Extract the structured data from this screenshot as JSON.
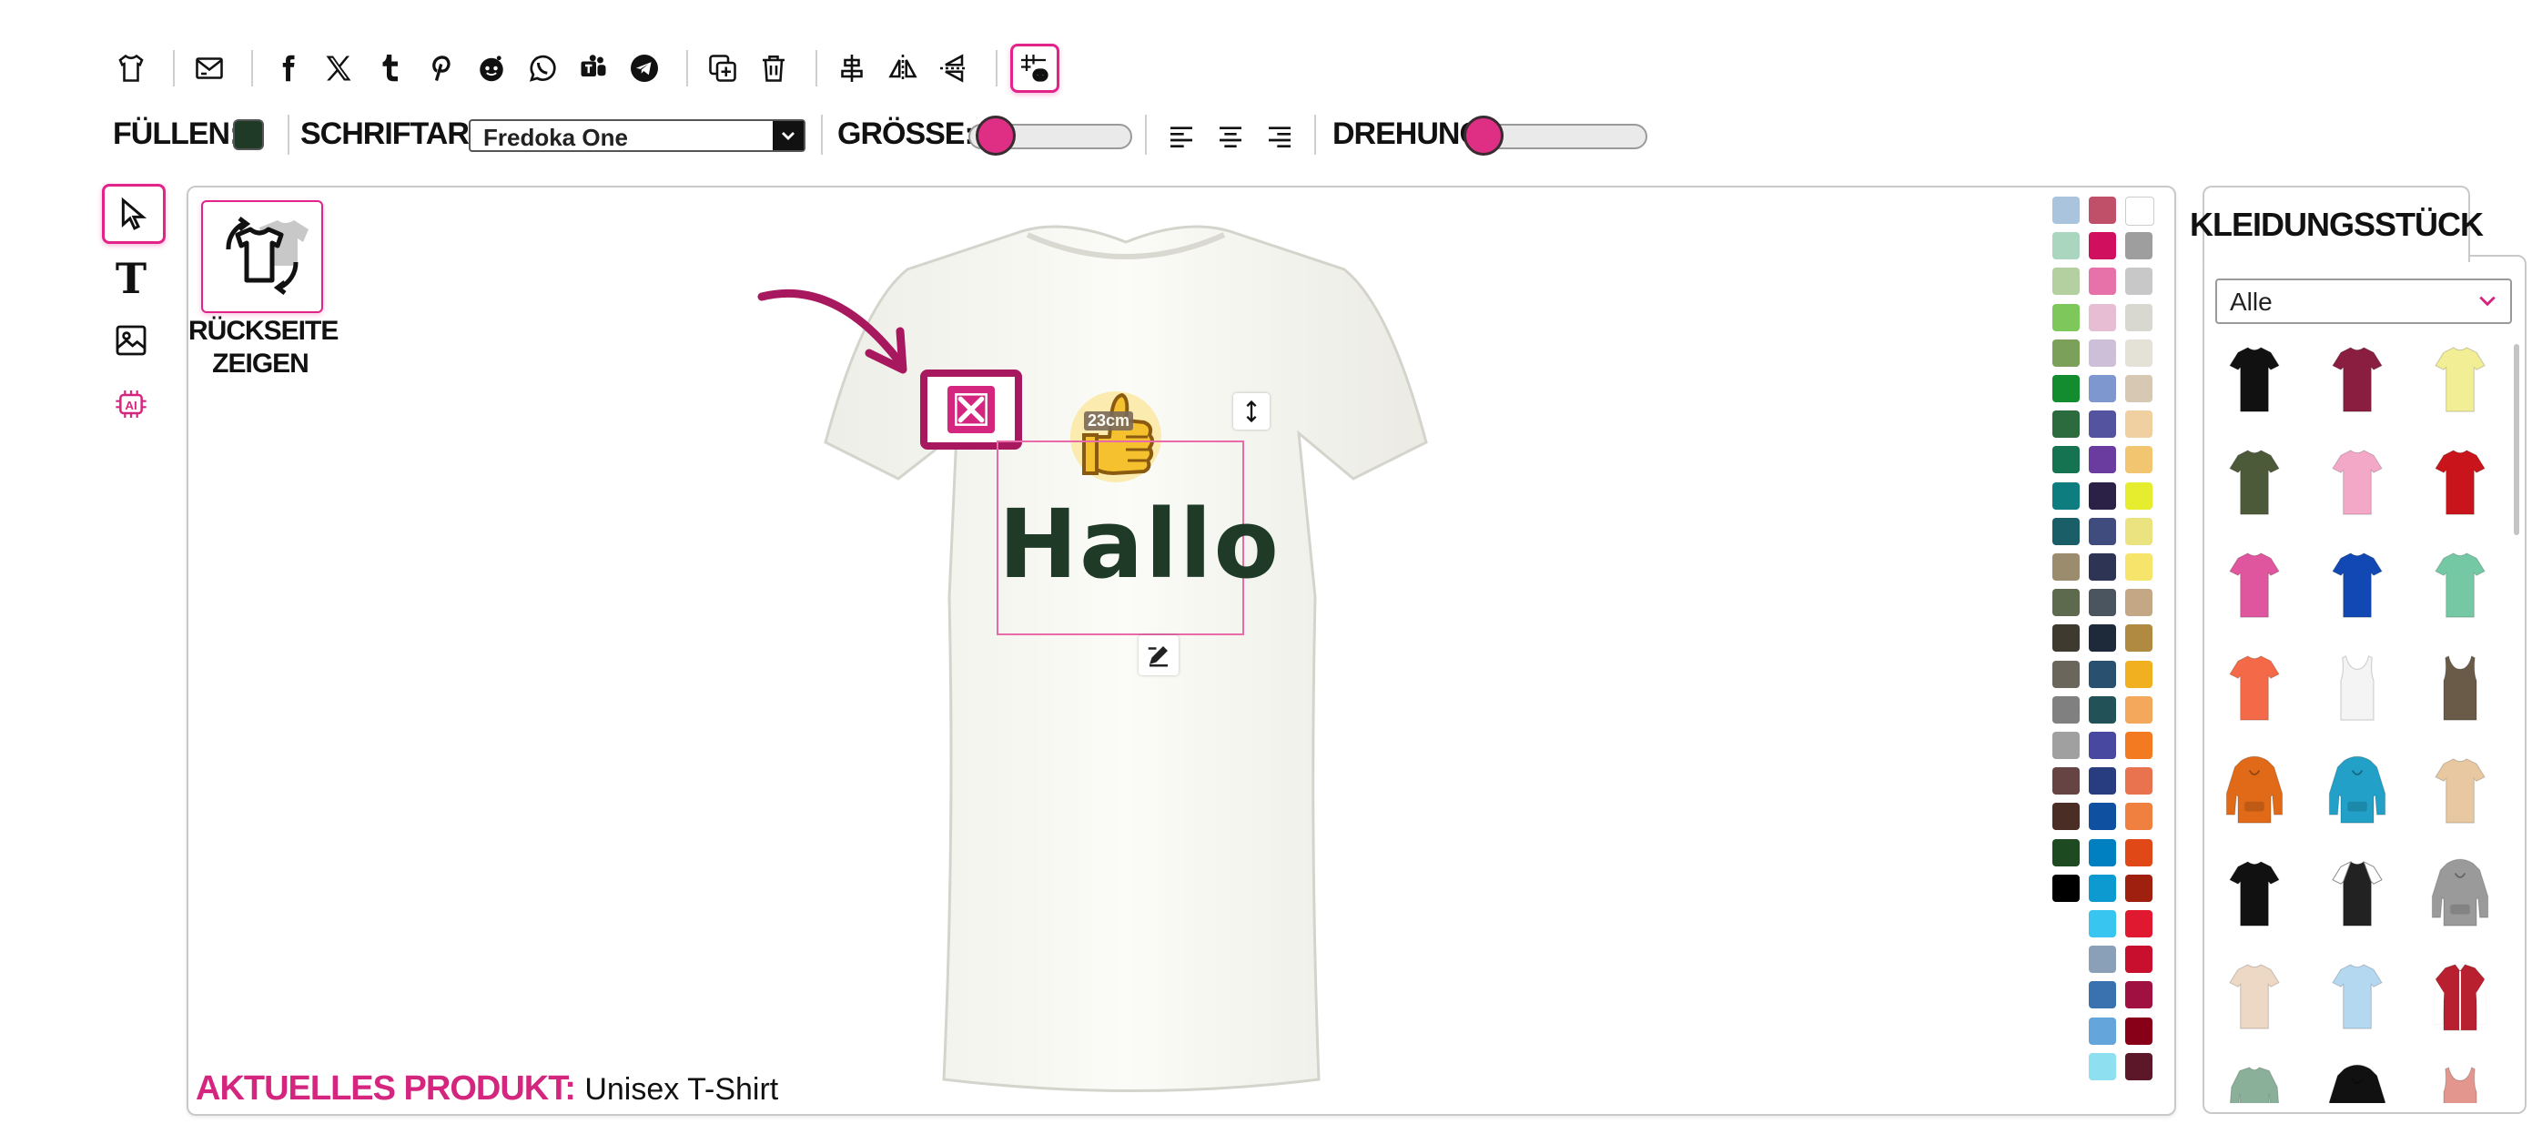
{
  "toolbar": {
    "icons": [
      "tshirt-icon",
      "envelope-icon",
      "facebook-icon",
      "x-icon",
      "tumblr-icon",
      "pinterest-icon",
      "reddit-icon",
      "whatsapp-icon",
      "teams-icon",
      "telegram-icon",
      "duplicate-icon",
      "trash-icon",
      "align-center-icon",
      "flip-horizontal-icon",
      "flip-vertical-icon",
      "grid-icon"
    ]
  },
  "options": {
    "fill_label": "FÜLLEN:",
    "fill_color": "#1f3a27",
    "font_label": "SCHRIFTART:",
    "font_value": "Fredoka One",
    "size_label": "GRÖSSE:",
    "size_fraction": 0.1,
    "rotation_label": "DREHUNG:",
    "rotation_fraction": 0.0
  },
  "left_tools": [
    "cursor-icon",
    "text-icon",
    "image-icon",
    "ai-icon"
  ],
  "canvas": {
    "back_side_label_1": "RÜCKSEITE",
    "back_side_label_2": "ZEIGEN",
    "design_text": "Hallo",
    "design_text_color": "#1f3a27",
    "size_badge": "23cm",
    "current_product_label": "AKTUELLES PRODUKT:",
    "current_product_value": "Unisex T-Shirt",
    "accent_color": "#d4267f",
    "swatch_colors": [
      [
        "#a9c4dc",
        "#c0506a",
        "#ffffff"
      ],
      [
        "#aad6c0",
        "#d0105f",
        "#9e9e9e"
      ],
      [
        "#b4cfa0",
        "#e771a9",
        "#c8c8c8"
      ],
      [
        "#7ec85b",
        "#e7bdd3",
        "#d8d8d0"
      ],
      [
        "#7aa05a",
        "#cdbfd8",
        "#e4e1d7"
      ],
      [
        "#138c2f",
        "#7f97cf",
        "#d6c8b3"
      ],
      [
        "#2b6b3e",
        "#5353a0",
        "#f0d0a0"
      ],
      [
        "#167352",
        "#6b3ca0",
        "#f2c670"
      ],
      [
        "#0e7d80",
        "#2b2146",
        "#e5ed2e"
      ],
      [
        "#1a5e68",
        "#404c7e",
        "#ebe380"
      ],
      [
        "#9b8c6e",
        "#2e3554",
        "#f6e56a"
      ],
      [
        "#5e6a4e",
        "#4b5560",
        "#c4a886"
      ],
      [
        "#3e3a2f",
        "#1e2a3a",
        "#b08a40"
      ],
      [
        "#6a665c",
        "#2a5070",
        "#f0b020"
      ],
      [
        "#808080",
        "#225258",
        "#f4a85c"
      ],
      [
        "#a0a0a0",
        "#4848a0",
        "#f37a20"
      ],
      [
        "#664444",
        "#283c80",
        "#e8734e"
      ],
      [
        "#4a2e25",
        "#1050a0",
        "#f08040"
      ],
      [
        "#1e4a22",
        "#0080c0",
        "#e04818"
      ],
      [
        "#000000",
        "#0d9ad0",
        "#a02010"
      ],
      [
        null,
        "#38c6f0",
        "#e01830"
      ],
      [
        null,
        "#8aa0b8",
        "#c8102e"
      ],
      [
        null,
        "#3a72b0",
        "#a01040"
      ],
      [
        null,
        "#64a6dc",
        "#880018"
      ],
      [
        null,
        "#8ee0f0",
        "#5c1828"
      ]
    ]
  },
  "panel": {
    "tab_label": "KLEIDUNGSSTÜCK",
    "filter_value": "Alle",
    "products": [
      {
        "color": "#111111",
        "type": "tee"
      },
      {
        "color": "#8a1e40",
        "type": "tee"
      },
      {
        "color": "#f2ee96",
        "type": "tee"
      },
      {
        "color": "#4d5a3a",
        "type": "tee"
      },
      {
        "color": "#f4a8c8",
        "type": "tee"
      },
      {
        "color": "#c8141a",
        "type": "tee"
      },
      {
        "color": "#e0569e",
        "type": "tee"
      },
      {
        "color": "#1248b4",
        "type": "tee"
      },
      {
        "color": "#74c9a4",
        "type": "tee"
      },
      {
        "color": "#f46a48",
        "type": "tee"
      },
      {
        "color": "#f4f4f4",
        "type": "tank"
      },
      {
        "color": "#6a5a48",
        "type": "tank"
      },
      {
        "color": "#e06a18",
        "type": "hoodie"
      },
      {
        "color": "#22a0c8",
        "type": "hoodie"
      },
      {
        "color": "#e8c8a0",
        "type": "tee"
      },
      {
        "color": "#111111",
        "type": "tee"
      },
      {
        "color": "#222222",
        "type": "raglan"
      },
      {
        "color": "#9a9a9a",
        "type": "hoodie"
      },
      {
        "color": "#ecd8c4",
        "type": "tee"
      },
      {
        "color": "#b4d8f0",
        "type": "tee"
      },
      {
        "color": "#b82030",
        "type": "jacket"
      },
      {
        "color": "#8ab09a",
        "type": "long"
      },
      {
        "color": "#111111",
        "type": "hoodie"
      },
      {
        "color": "#e2968e",
        "type": "tank"
      }
    ]
  }
}
